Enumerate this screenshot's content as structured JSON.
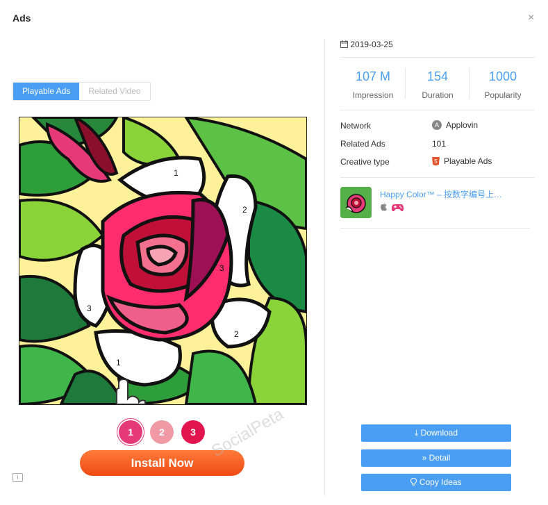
{
  "dialog": {
    "title": "Ads",
    "close_glyph": "×"
  },
  "tabs": [
    {
      "label": "Playable Ads",
      "active": true
    },
    {
      "label": "Related Video",
      "active": false
    }
  ],
  "preview": {
    "numbers": [
      "1",
      "2",
      "3",
      "3",
      "2",
      "1"
    ],
    "swatches": [
      {
        "label": "1",
        "color": "#e63a78"
      },
      {
        "label": "2",
        "color": "#f19aa6"
      },
      {
        "label": "3",
        "color": "#e2154e"
      }
    ],
    "install_label": "Install Now",
    "watermark": "SocialPeta"
  },
  "details": {
    "date": "2019-03-25",
    "stats": [
      {
        "value": "107 M",
        "label": "Impression"
      },
      {
        "value": "154",
        "label": "Duration"
      },
      {
        "value": "1000",
        "label": "Popularity"
      }
    ],
    "rows": [
      {
        "label": "Network",
        "value": "Applovin",
        "icon": "applovin-icon"
      },
      {
        "label": "Related Ads",
        "value": "101",
        "icon": ""
      },
      {
        "label": "Creative type",
        "value": "Playable Ads",
        "icon": "html5-icon"
      }
    ],
    "app": {
      "name": "Happy Color™ – 按数字编号上…",
      "platforms": [
        "apple-icon",
        "gamepad-icon"
      ]
    }
  },
  "actions": {
    "download": "Download",
    "detail": "Detail",
    "copy_ideas": "Copy Ideas"
  },
  "colors": {
    "accent": "#4a9ff5",
    "install": "#f35a1c"
  }
}
